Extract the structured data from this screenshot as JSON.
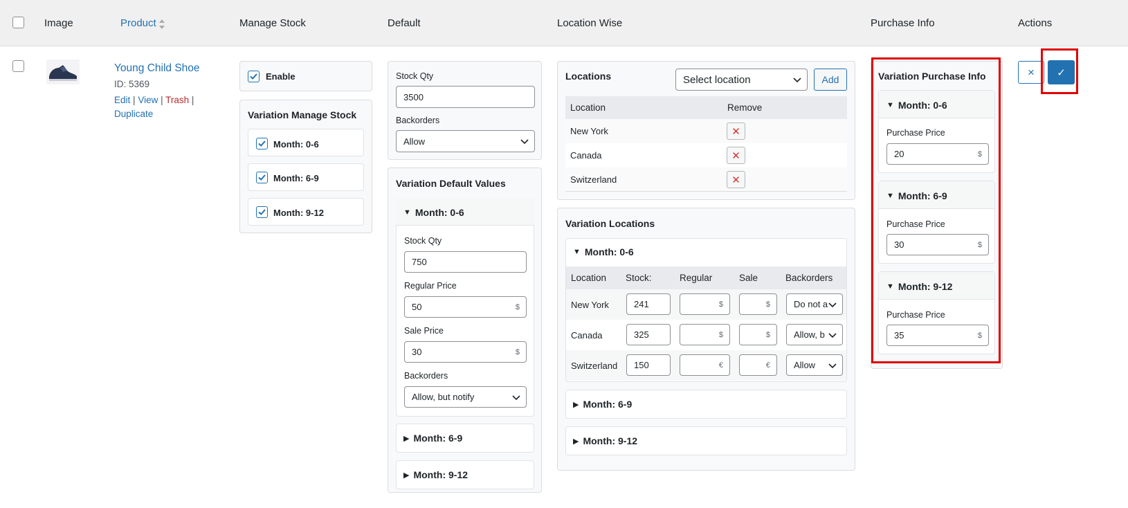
{
  "columns": {
    "image": "Image",
    "product": "Product",
    "manage_stock": "Manage Stock",
    "default": "Default",
    "location_wise": "Location Wise",
    "purchase_info": "Purchase Info",
    "actions": "Actions"
  },
  "product": {
    "name": "Young Child Shoe",
    "id_text": "ID: 5369",
    "actions": {
      "edit": "Edit",
      "view": "View",
      "trash": "Trash",
      "duplicate": "Duplicate"
    },
    "separator": "|",
    "thumbnail_icon": "shoe-thumbnail"
  },
  "manage_stock": {
    "enable_label": "Enable",
    "enable_checked": true,
    "variation_title": "Variation Manage Stock",
    "variations": [
      {
        "label": "Month: 0-6",
        "checked": true
      },
      {
        "label": "Month: 6-9",
        "checked": true
      },
      {
        "label": "Month: 9-12",
        "checked": true
      }
    ]
  },
  "default": {
    "stock_qty_label": "Stock Qty",
    "stock_qty_value": "3500",
    "backorders_label": "Backorders",
    "backorders_value": "Allow",
    "variation_title": "Variation Default Values",
    "variation_open": {
      "title": "Month: 0-6",
      "stock_qty_label": "Stock Qty",
      "stock_qty_value": "750",
      "regular_price_label": "Regular Price",
      "regular_price_value": "50",
      "sale_price_label": "Sale Price",
      "sale_price_value": "30",
      "currency": "$",
      "backorders_label": "Backorders",
      "backorders_value": "Allow, but notify"
    },
    "variation_closed": [
      "Month: 6-9",
      "Month: 9-12"
    ]
  },
  "location_wise": {
    "locations_title": "Locations",
    "select_placeholder": "Select location",
    "add_label": "Add",
    "table_headers": {
      "location": "Location",
      "remove": "Remove"
    },
    "locations": [
      "New York",
      "Canada",
      "Switzerland"
    ],
    "remove_glyph": "✕",
    "variation_title": "Variation Locations",
    "variation_open": {
      "title": "Month: 0-6",
      "headers": {
        "location": "Location",
        "stock": "Stock:",
        "regular": "Regular",
        "sale": "Sale",
        "backorders": "Backorders"
      },
      "rows": [
        {
          "location": "New York",
          "stock": "241",
          "regular": "",
          "sale": "",
          "currency": "$",
          "backorders": "Do not a"
        },
        {
          "location": "Canada",
          "stock": "325",
          "regular": "",
          "sale": "",
          "currency": "$",
          "backorders": "Allow, b"
        },
        {
          "location": "Switzerland",
          "stock": "150",
          "regular": "",
          "sale": "",
          "currency": "€",
          "backorders": "Allow"
        }
      ]
    },
    "variation_closed": [
      "Month: 6-9",
      "Month: 9-12"
    ]
  },
  "purchase_info": {
    "title": "Variation Purchase Info",
    "price_label": "Purchase Price",
    "currency": "$",
    "variations": [
      {
        "title": "Month: 0-6",
        "price": "20"
      },
      {
        "title": "Month: 6-9",
        "price": "30"
      },
      {
        "title": "Month: 9-12",
        "price": "35"
      }
    ]
  },
  "actions": {
    "cancel_glyph": "×",
    "save_glyph": "✓"
  },
  "colors": {
    "accent": "#2271b1",
    "highlight": "#e00000",
    "danger": "#d63638",
    "header_bg": "#f0f0f1"
  }
}
